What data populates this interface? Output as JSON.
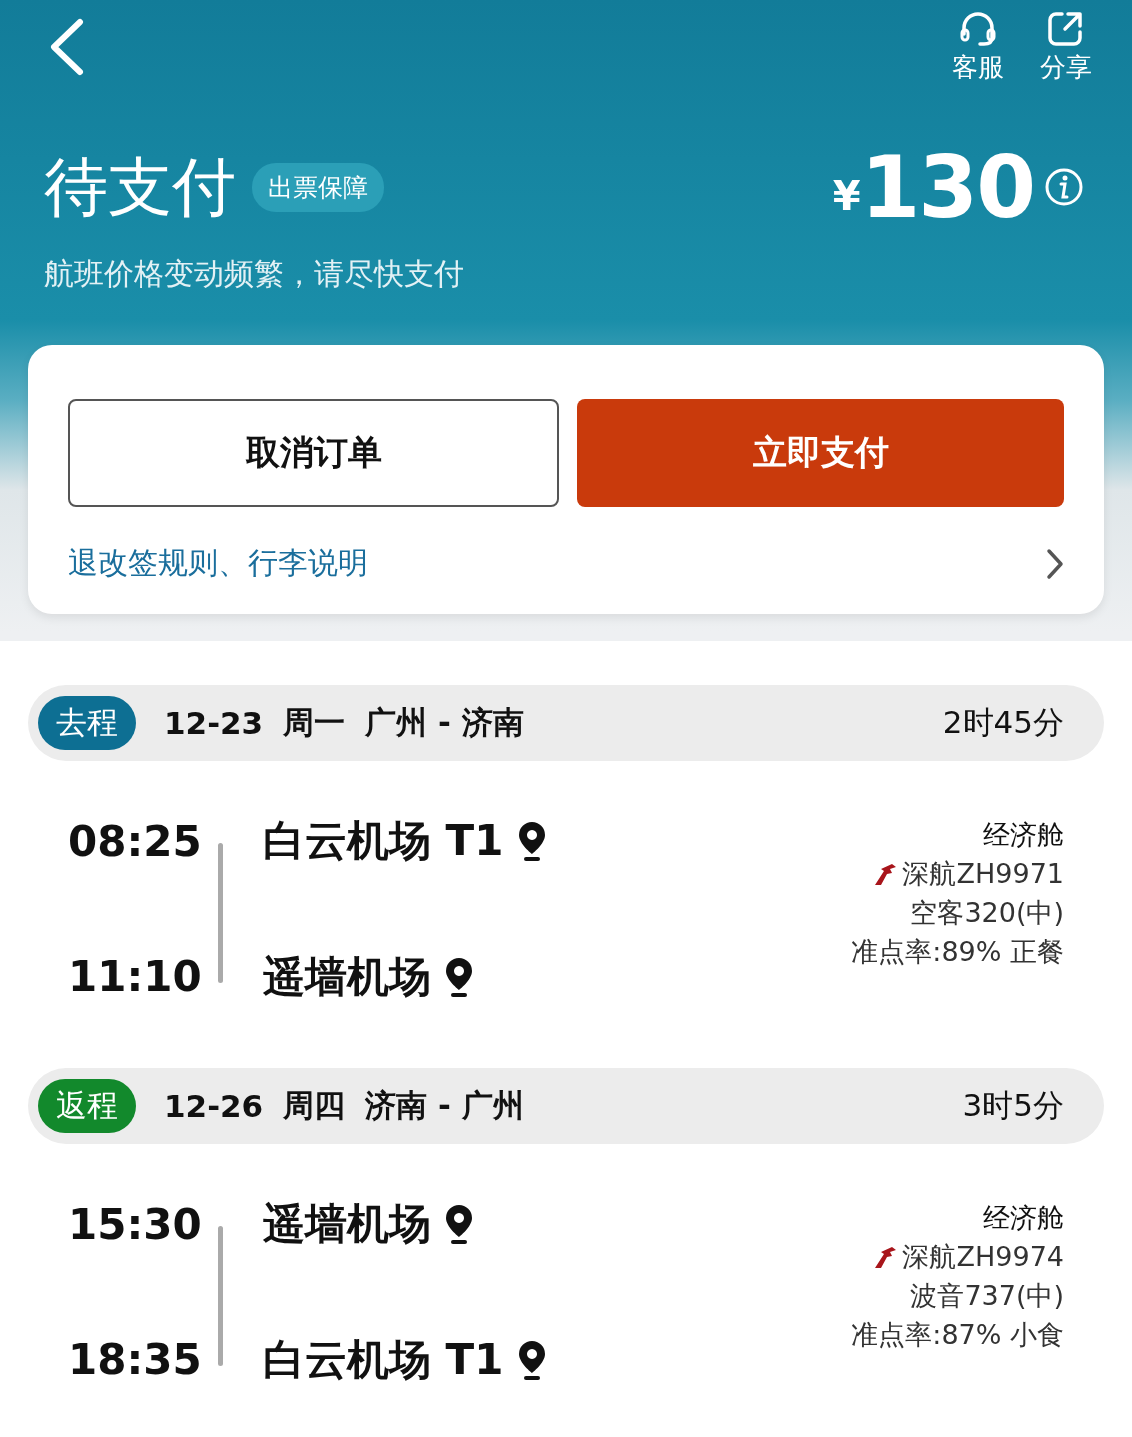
{
  "header": {
    "actions": [
      {
        "kind": "headset",
        "label": "客服"
      },
      {
        "kind": "share",
        "label": "分享"
      }
    ],
    "status": "待支付",
    "badge": "出票保障",
    "notice": "航班价格变动频繁，请尽快支付",
    "price": {
      "currency": "¥",
      "amount": "130"
    }
  },
  "actions_card": {
    "buttons": [
      {
        "kind": "secondary",
        "label": "取消订单"
      },
      {
        "kind": "primary",
        "label": "立即支付"
      }
    ],
    "rules_link": "退改签规则、行李说明"
  },
  "legs": [
    {
      "tag": "去程",
      "color": "#0d6f93",
      "date": "12-23",
      "weekday": "周一",
      "route": "广州 - 济南",
      "duration": "2时45分",
      "depart_time": "08:25",
      "arrive_time": "11:10",
      "depart_airport": "白云机场 T1",
      "arrive_airport": "遥墙机场",
      "cabin": "经济舱",
      "flight": "深航ZH9971",
      "aircraft": "空客320(中)",
      "punctuality": "准点率:89% 正餐"
    },
    {
      "tag": "返程",
      "color": "#12892c",
      "date": "12-26",
      "weekday": "周四",
      "route": "济南 - 广州",
      "duration": "3时5分",
      "depart_time": "15:30",
      "arrive_time": "18:35",
      "depart_airport": "遥墙机场",
      "arrive_airport": "白云机场 T1",
      "cabin": "经济舱",
      "flight": "深航ZH9974",
      "aircraft": "波音737(中)",
      "punctuality": "准点率:87% 小食"
    }
  ]
}
